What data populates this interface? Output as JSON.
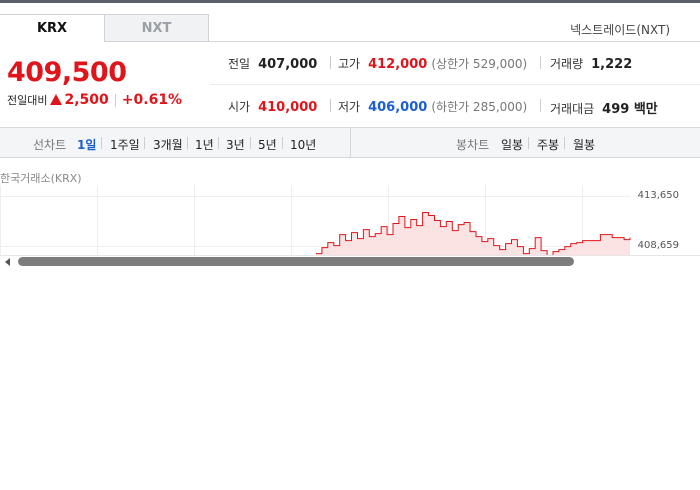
{
  "tabs": [
    {
      "label": "KRX",
      "active": true
    },
    {
      "label": "NXT",
      "active": false
    }
  ],
  "nxt_link": "넥스트레이드(NXT)",
  "price": "409,500",
  "change": {
    "label": "전일대비",
    "value": "2,500",
    "rate": "+0.61%",
    "direction": "up"
  },
  "stats": {
    "prev_close": {
      "label": "전일",
      "value": "407,000"
    },
    "high": {
      "label": "고가",
      "value": "412,000",
      "limit": "(상한가 529,000)"
    },
    "volume": {
      "label": "거래량",
      "value": "1,222"
    },
    "open": {
      "label": "시가",
      "value": "410,000"
    },
    "low": {
      "label": "저가",
      "value": "406,000",
      "limit": "(하한가 285,000)"
    },
    "amount": {
      "label": "거래대금",
      "value": "499 백만"
    }
  },
  "period_bar": {
    "line_chart_label": "선차트",
    "line_periods": [
      "1일",
      "1주일",
      "3개월",
      "1년",
      "3년",
      "5년",
      "10년"
    ],
    "candle_chart_label": "봉차트",
    "candle_periods": [
      "일봉",
      "주봉",
      "월봉"
    ]
  },
  "chart": {
    "exchange_label": "한국거래소(KRX)",
    "y_ticks": [
      "413,650",
      "408,659"
    ]
  },
  "chart_data": {
    "type": "area",
    "title": "",
    "y_ticks": [
      413650,
      408659
    ],
    "series": [
      {
        "values": [
          407900,
          408500,
          409000,
          408700,
          409800,
          409200,
          410000,
          409400,
          410300,
          409600,
          409900,
          410600,
          409800,
          410900,
          411600,
          410500,
          411300,
          410700,
          412000,
          411700,
          411200,
          410600,
          411100,
          410200,
          410800,
          411000,
          410100,
          409600,
          409100,
          409400,
          408700,
          408300,
          408900,
          409300,
          408600,
          407900,
          408400,
          409500,
          408200,
          407600,
          408100,
          408300,
          408600,
          408900,
          409000,
          409200,
          409200,
          409200,
          409800,
          409800,
          409500,
          409500,
          409300,
          409500
        ]
      }
    ],
    "colors": {
      "line": "#e0151b",
      "fill": "#fbe3e4"
    }
  },
  "colors": {
    "up": "#e0151b",
    "down": "#1a5fd1",
    "active": "#1a5fd1"
  }
}
